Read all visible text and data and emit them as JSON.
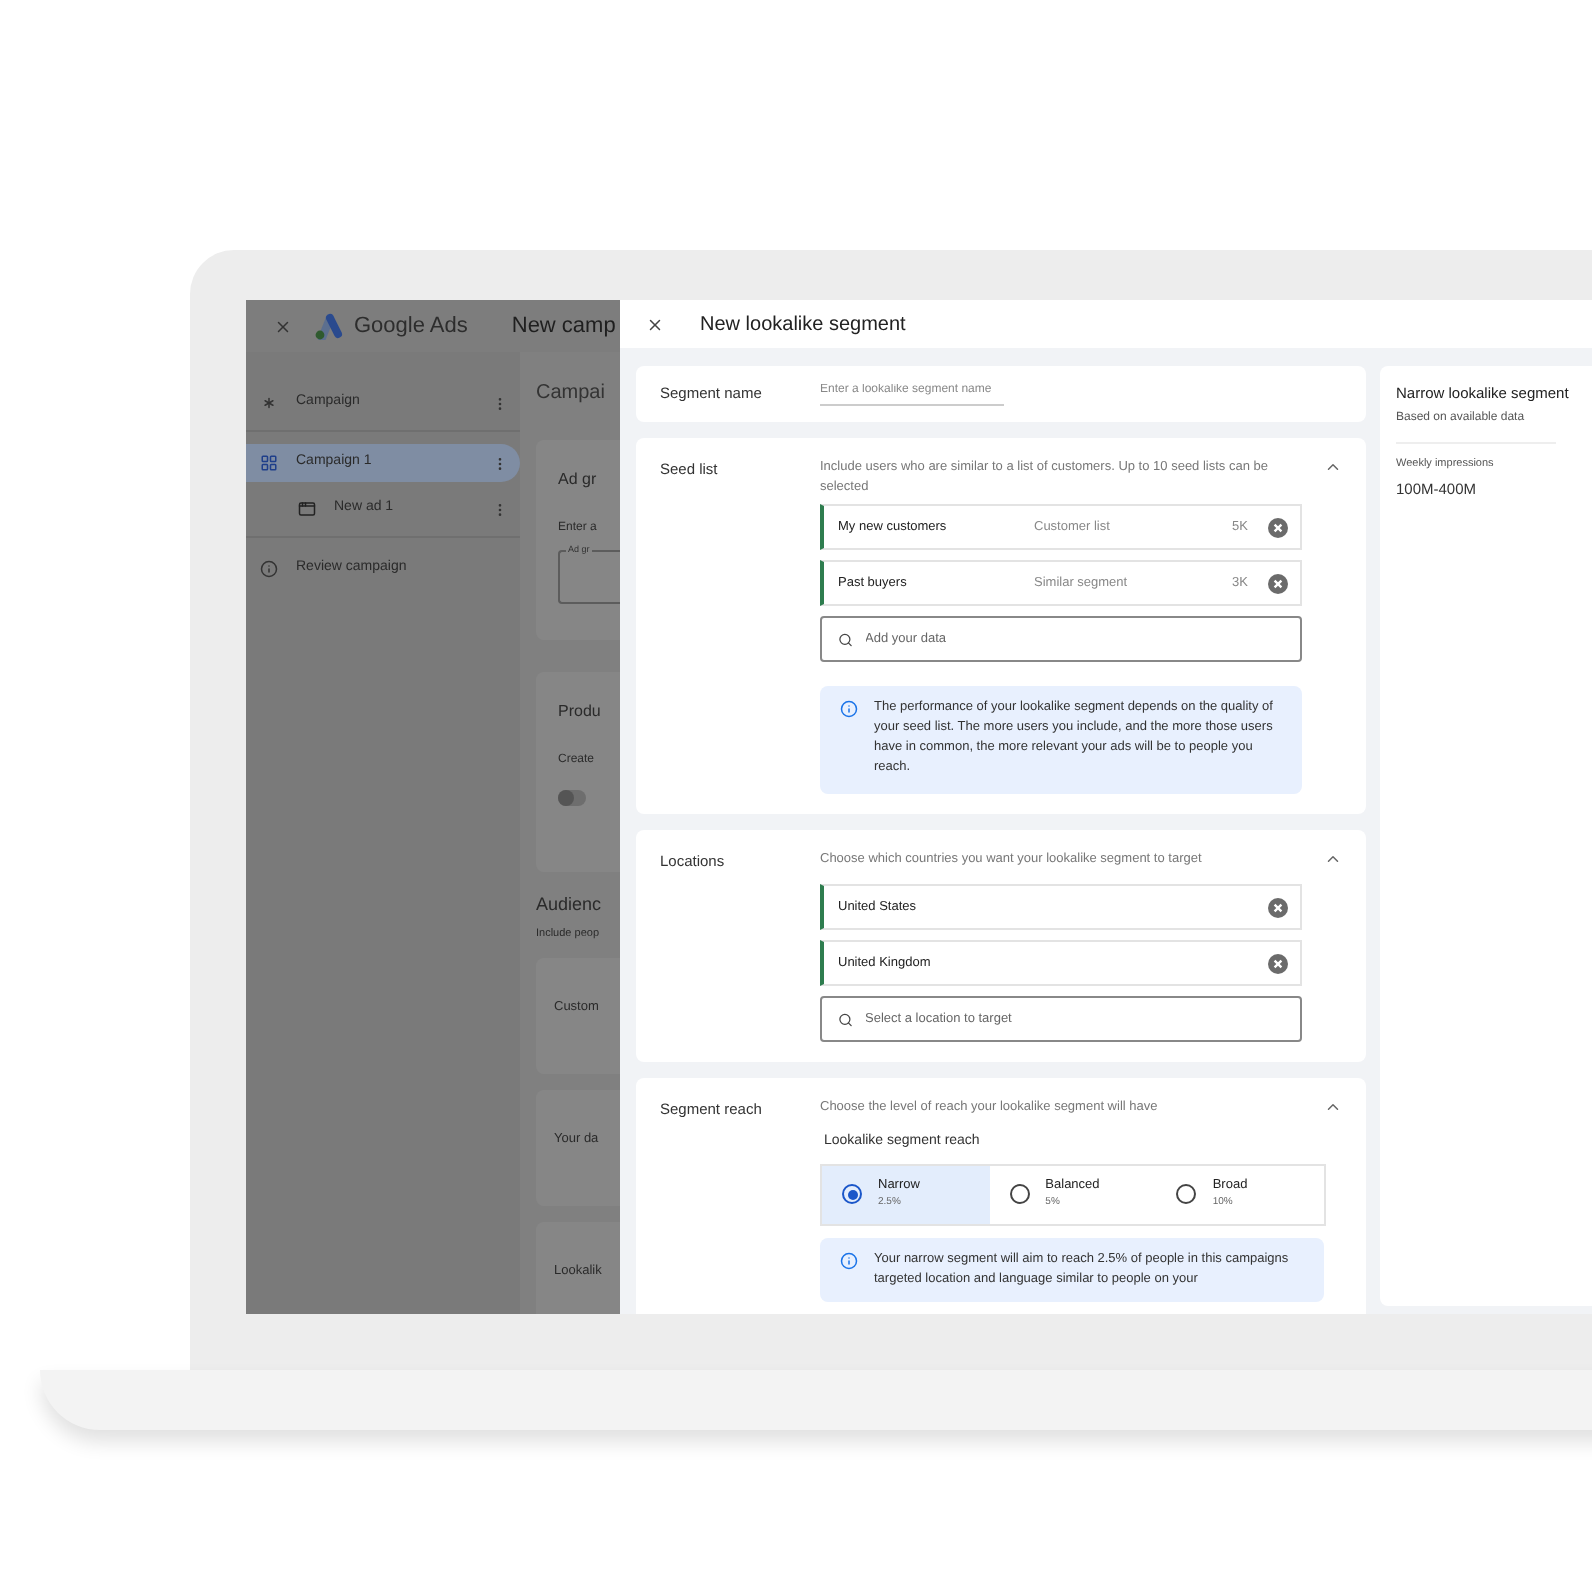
{
  "background_app": {
    "header": {
      "logo_text": "Google Ads",
      "title": "New camp"
    },
    "sidebar": [
      {
        "label": "Campaign",
        "menu": true,
        "selected": false
      },
      {
        "label": "Campaign 1",
        "menu": true,
        "selected": true,
        "children": [
          {
            "label": "New ad 1",
            "menu": true,
            "selected": false
          }
        ]
      },
      {
        "label": "Review campaign",
        "menu": false,
        "selected": false
      }
    ],
    "main": {
      "heading": "Campai",
      "cards": [
        {
          "kind": "field",
          "title": "Ad gr",
          "text": "Enter a",
          "field_label": "Ad gr"
        },
        {
          "kind": "toggle",
          "title": "Produ",
          "text": "Create",
          "toggle_on": false
        }
      ],
      "section_title": "Audienc",
      "section_text": "Include peop",
      "section_cards": [
        "Custom",
        "Your da",
        "Lookalik"
      ]
    }
  },
  "dialog": {
    "title": "New lookalike segment",
    "segment_name": {
      "label": "Segment name",
      "placeholder": "Enter a lookalike segment name"
    },
    "seed_list": {
      "label": "Seed list",
      "description": "Include users who are similar to a list of customers. Up to 10 seed lists can be selected",
      "expanded": true,
      "items": [
        {
          "name": "My new customers",
          "type": "Customer list",
          "size": "5K"
        },
        {
          "name": "Past buyers",
          "type": "Similar segment",
          "size": "3K"
        }
      ],
      "search_placeholder": "Add your data",
      "info": "The performance of your lookalike segment depends on the quality of your seed list. The more users you include, and the more those users have in common, the more relevant your ads will be to people you reach."
    },
    "locations": {
      "label": "Locations",
      "description": "Choose which countries you want your lookalike segment to target",
      "expanded": true,
      "items": [
        {
          "name": "United States"
        },
        {
          "name": "United Kingdom"
        }
      ],
      "search_placeholder": "Select a location to target"
    },
    "segment_reach": {
      "label": "Segment reach",
      "description": "Choose the level of reach your lookalike segment will have",
      "expanded": true,
      "group_label": "Lookalike segment reach",
      "options": [
        {
          "label": "Narrow",
          "value": "2.5%",
          "selected": true
        },
        {
          "label": "Balanced",
          "value": "5%",
          "selected": false
        },
        {
          "label": "Broad",
          "value": "10%",
          "selected": false
        }
      ],
      "info": "Your narrow segment will aim to reach 2.5% of people in this campaigns targeted location and language similar to people on your"
    },
    "summary": {
      "title": "Narrow lookalike segment",
      "subtitle": "Based on available data",
      "metric_label": "Weekly impressions",
      "metric_value": "100M-400M"
    }
  }
}
